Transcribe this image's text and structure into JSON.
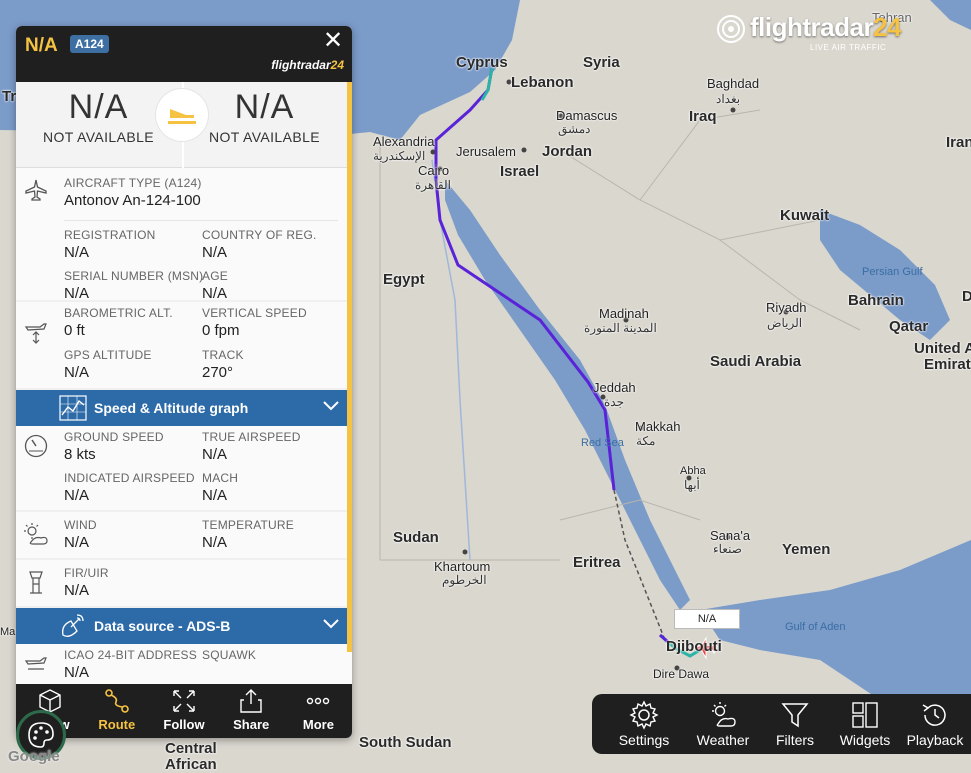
{
  "flight": {
    "callsign": "N/A",
    "type_code": "A124",
    "brand_word": "flightradar",
    "brand_num": "24"
  },
  "route": {
    "origin": {
      "code": "N/A",
      "city": "NOT AVAILABLE"
    },
    "destination": {
      "code": "N/A",
      "city": "NOT AVAILABLE"
    }
  },
  "aircraft": {
    "type_label": "AIRCRAFT TYPE (A124)",
    "type_value": "Antonov An-124-100",
    "registration_label": "REGISTRATION",
    "registration_value": "N/A",
    "country_label": "COUNTRY OF REG.",
    "country_value": "N/A",
    "serial_label": "SERIAL NUMBER (MSN)",
    "serial_value": "N/A",
    "age_label": "AGE",
    "age_value": "N/A"
  },
  "altitude": {
    "baro_label": "BAROMETRIC ALT.",
    "baro_value": "0 ft",
    "vs_label": "VERTICAL SPEED",
    "vs_value": "0 fpm",
    "gps_label": "GPS ALTITUDE",
    "gps_value": "N/A",
    "track_label": "TRACK",
    "track_value": "270°"
  },
  "graph_bar": {
    "label": "Speed & Altitude graph"
  },
  "speed": {
    "gs_label": "GROUND SPEED",
    "gs_value": "8 kts",
    "tas_label": "TRUE AIRSPEED",
    "tas_value": "N/A",
    "ias_label": "INDICATED AIRSPEED",
    "ias_value": "N/A",
    "mach_label": "MACH",
    "mach_value": "N/A"
  },
  "weather": {
    "wind_label": "WIND",
    "wind_value": "N/A",
    "temp_label": "TEMPERATURE",
    "temp_value": "N/A"
  },
  "fir": {
    "label": "FIR/UIR",
    "value": "N/A"
  },
  "source_bar": {
    "label": "Data source - ADS-B"
  },
  "icao": {
    "icao_label": "ICAO 24-BIT ADDRESS",
    "icao_value": "N/A",
    "squawk_label": "SQUAWK"
  },
  "panel_nav": [
    {
      "label": "w",
      "icon": "cube-icon"
    },
    {
      "label": "Route",
      "icon": "route-icon",
      "active": true
    },
    {
      "label": "Follow",
      "icon": "follow-icon"
    },
    {
      "label": "Share",
      "icon": "share-icon"
    },
    {
      "label": "More",
      "icon": "more-icon"
    }
  ],
  "map_nav": [
    {
      "label": "Settings",
      "icon": "gear-icon"
    },
    {
      "label": "Weather",
      "icon": "weather-icon"
    },
    {
      "label": "Filters",
      "icon": "filter-icon"
    },
    {
      "label": "Widgets",
      "icon": "widgets-icon"
    },
    {
      "label": "Playback",
      "icon": "playback-icon"
    }
  ],
  "logo": {
    "word": "flightradar",
    "num": "24",
    "sub": "LIVE AIR TRAFFIC"
  },
  "map_labels": {
    "cyprus": "Cyprus",
    "syria": "Syria",
    "tehran": "Tehran",
    "lebanon": "Lebanon",
    "baghdad": "Baghdad",
    "baghdad_ar": "بغداد",
    "damascus": "Damascus",
    "damascus_ar": "دمشق",
    "iraq": "Iraq",
    "iran": "Iran",
    "alexandria": "Alexandria",
    "alexandria_ar": "الإسكندرية",
    "jerusalem": "Jerusalem",
    "jordan": "Jordan",
    "israel": "Israel",
    "cairo": "Cairo",
    "cairo_ar": "القاهرة",
    "kuwait": "Kuwait",
    "persian_gulf": "Persian Gulf",
    "egypt": "Egypt",
    "bahrain": "Bahrain",
    "madinah": "Madinah",
    "madinah_ar": "المدينة المنورة",
    "riyadh": "Riyadh",
    "riyadh_ar": "الرياض",
    "qatar": "Qatar",
    "united": "United A",
    "emirates": "Emirat",
    "saudi": "Saudi Arabia",
    "jeddah": "Jeddah",
    "jeddah_ar": "جدة",
    "makkah": "Makkah",
    "makkah_ar": "مكة",
    "red_sea": "Red Sea",
    "abha": "Abha",
    "abha_ar": "أبها",
    "sanaa": "Sana'a",
    "sanaa_ar": "صنعاء",
    "sudan": "Sudan",
    "yemen": "Yemen",
    "eritrea": "Eritrea",
    "khartoum": "Khartoum",
    "khartoum_ar": "الخرطوم",
    "gulf_aden": "Gulf of Aden",
    "djibouti": "Djibouti",
    "dire_dawa": "Dire Dawa",
    "south_sudan": "South Sudan",
    "central": "Central",
    "african": "African",
    "left_tr": "Tr",
    "left_ma": "Ma",
    "right_d": "D"
  },
  "plane_tag": "N/A",
  "google": "Google"
}
